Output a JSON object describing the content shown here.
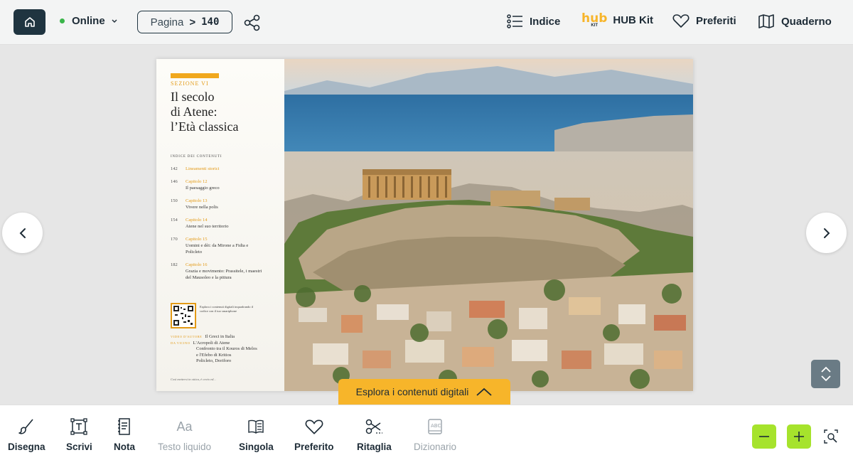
{
  "topbar": {
    "status": "Online",
    "page_label": "Pagina",
    "page_sep": ">",
    "page_number": "140",
    "index_label": "Indice",
    "hubkit_logo_text": "hub",
    "hubkit_logo_sub": "KIT",
    "hubkit_label": "HUB Kit",
    "favorites_label": "Preferiti",
    "notebook_label": "Quaderno"
  },
  "book": {
    "section_label": "SEZIONE VI",
    "title_line1": "Il secolo",
    "title_line2": "di Atene:",
    "title_line3": "l’Età classica",
    "index_heading": "INDICE DEI CONTENUTI",
    "index": [
      {
        "page": "142",
        "chapter": "Lineamenti storici",
        "text": ""
      },
      {
        "page": "146",
        "chapter": "Capitolo 12",
        "text": "Il paesaggio greco"
      },
      {
        "page": "150",
        "chapter": "Capitolo 13",
        "text": "Vivere nella polis"
      },
      {
        "page": "154",
        "chapter": "Capitolo 14",
        "text": "Atene nel suo territorio"
      },
      {
        "page": "170",
        "chapter": "Capitolo 15",
        "text": "Uomini e dèi: da Mirone a Fidia e Policleto"
      },
      {
        "page": "182",
        "chapter": "Capitolo 16",
        "text": "Grazia e movimento: Prassitele, i maestri del Mausoleo e la pittura"
      }
    ],
    "qr_text": "Esplora i contenuti digitali inquadrando il codice con il tuo smartphone",
    "video_tag": "VIDEO D'AUTORE",
    "video_title": "Il Greci in Italia",
    "closeup_tag": "DA VICINO",
    "closeup_line1": "L'Acropoli di Atene",
    "closeup_line2": "Confronto tra il Kouros di Melos",
    "closeup_line3": "e l'Efebo di Kritios",
    "closeup_line4": "Policleto, Doriforo",
    "foot_note": "Così mettersi in ottica, è ovvio ed..."
  },
  "explore_label": "Esplora i contenuti digitali",
  "toolbar": {
    "tools": [
      {
        "label": "Disegna",
        "disabled": false
      },
      {
        "label": "Scrivi",
        "disabled": false
      },
      {
        "label": "Nota",
        "disabled": false
      },
      {
        "label": "Testo liquido",
        "disabled": true
      },
      {
        "label": "Singola",
        "disabled": false
      },
      {
        "label": "Preferito",
        "disabled": false
      },
      {
        "label": "Ritaglia",
        "disabled": false
      },
      {
        "label": "Dizionario",
        "disabled": true
      }
    ],
    "text_liquid_icon": "Aa"
  },
  "colors": {
    "dark": "#1f3440",
    "accent_orange": "#f7b52a",
    "zoom_green": "#a6e32c",
    "online_green": "#3ab54a"
  }
}
